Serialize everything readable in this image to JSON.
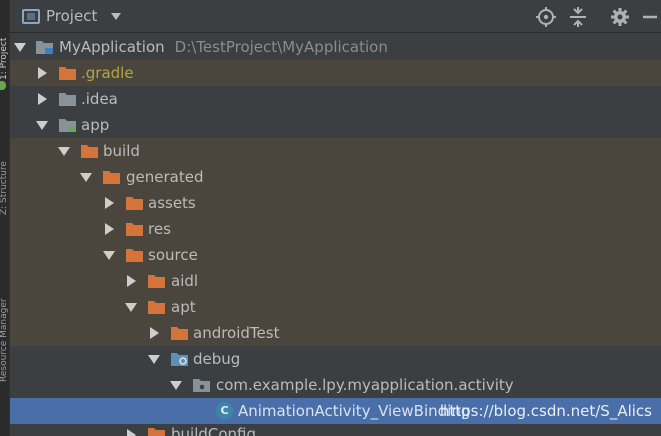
{
  "side_strip": {
    "tabs": [
      "1: Project",
      "Z: Structure",
      "Resource Manager"
    ]
  },
  "header": {
    "title": "Project",
    "icons": {
      "title_icon": "project-window-icon",
      "dropdown": "chevron-down-icon",
      "locate": "crosshair-icon",
      "collapse": "collapse-all-icon",
      "settings": "gear-icon",
      "hide": "minimize-icon"
    }
  },
  "tree": {
    "rows": [
      {
        "label": "MyApplication",
        "path": "D:\\TestProject\\MyApplication",
        "expanded": true
      },
      {
        "label": ".gradle",
        "expanded": false
      },
      {
        "label": ".idea",
        "expanded": false
      },
      {
        "label": "app",
        "expanded": true
      },
      {
        "label": "build",
        "expanded": true
      },
      {
        "label": "generated",
        "expanded": true
      },
      {
        "label": "assets",
        "expanded": false
      },
      {
        "label": "res",
        "expanded": false
      },
      {
        "label": "source",
        "expanded": true
      },
      {
        "label": "aidl",
        "expanded": false
      },
      {
        "label": "apt",
        "expanded": true
      },
      {
        "label": "androidTest",
        "expanded": false
      },
      {
        "label": "debug",
        "expanded": true
      },
      {
        "label": "com.example.lpy.myapplication.activity",
        "expanded": true
      },
      {
        "label": "AnimationActivity_ViewBinding",
        "class_letter": "C",
        "selected": true
      },
      {
        "label": "buildConfig",
        "expanded": false
      }
    ]
  },
  "watermark": "https://blog.csdn.net/S_Alics",
  "colors": {
    "background": "#3c3f41",
    "excluded_row": "#4b463d",
    "selected_row": "#4a6fa8",
    "folder_orange": "#d5743a",
    "folder_gray": "#8a9299",
    "folder_blue": "#5f8fb7",
    "gradle_text": "#b4a543"
  }
}
